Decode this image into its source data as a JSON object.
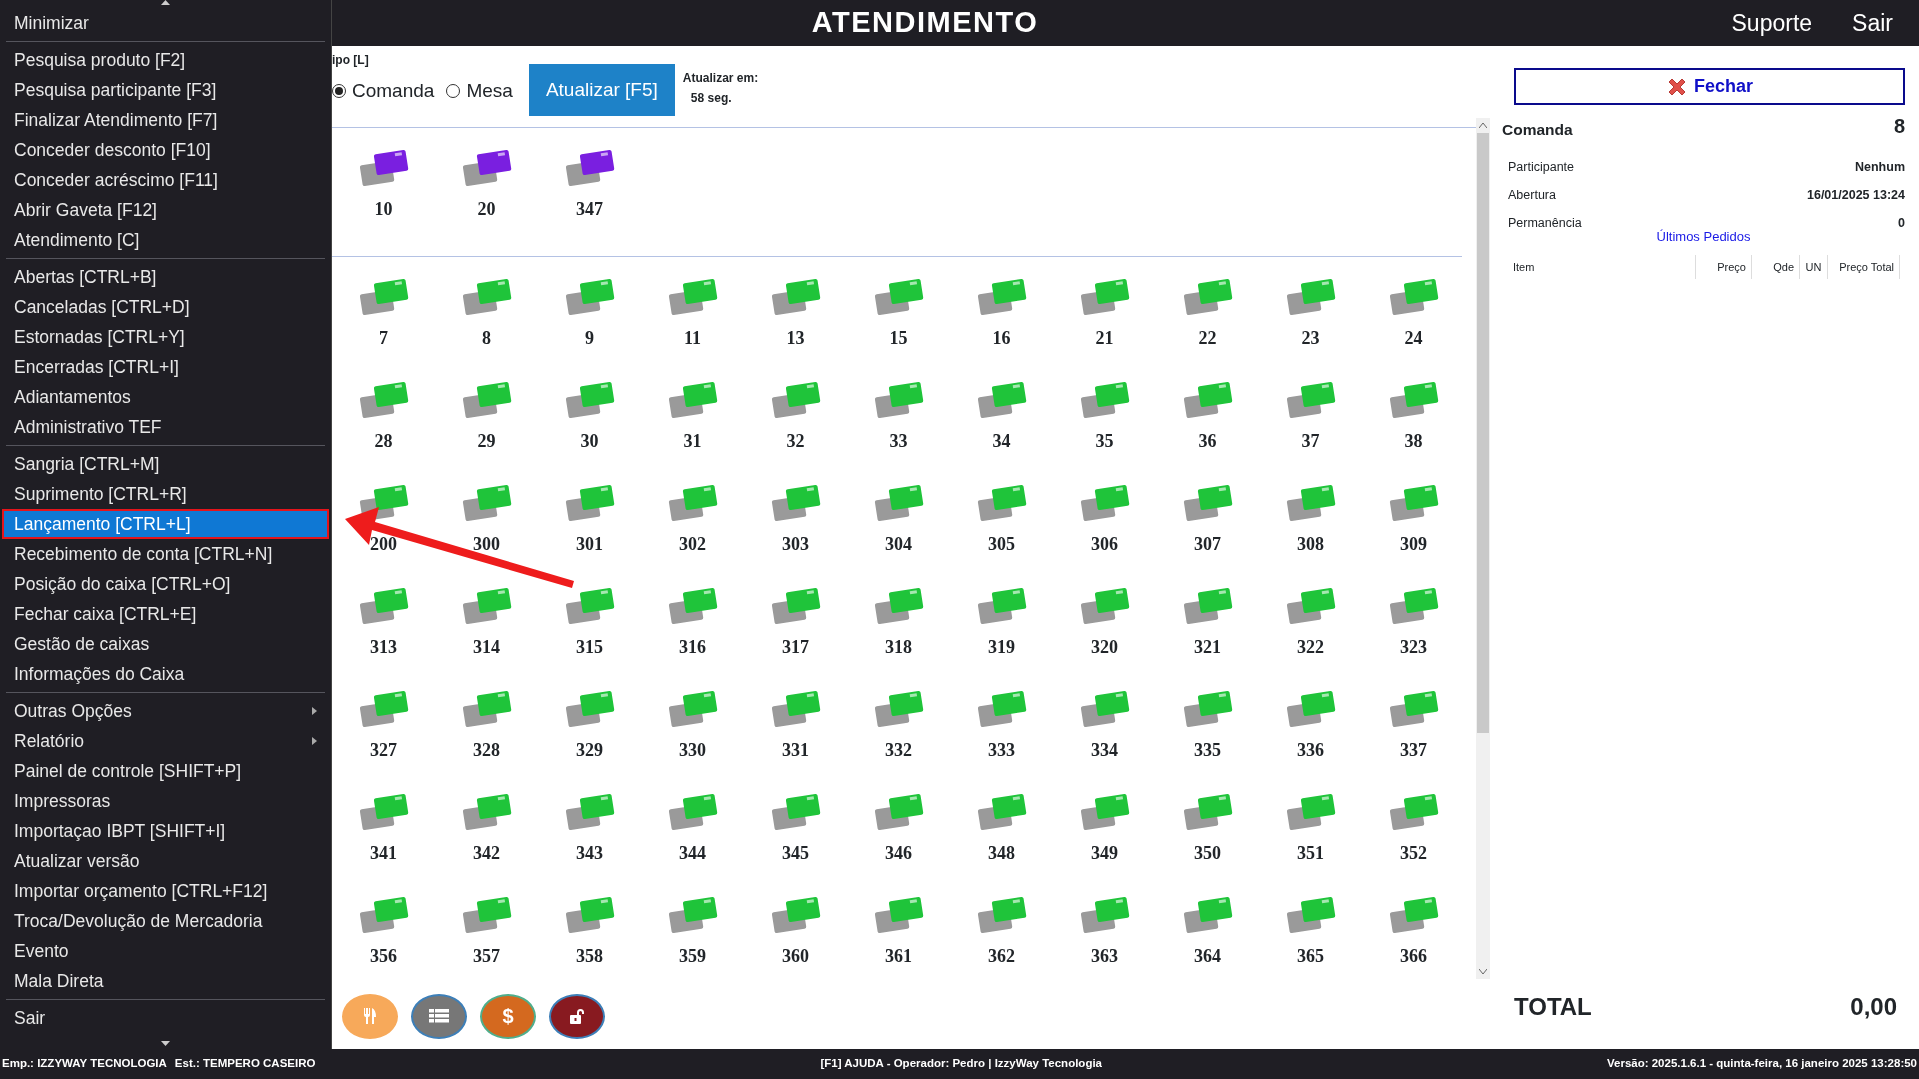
{
  "menu": {
    "groups": [
      {
        "items": [
          {
            "label": "Minimizar",
            "selected": false,
            "submenu": false
          }
        ]
      },
      {
        "items": [
          {
            "label": "Pesquisa produto [F2]",
            "selected": false,
            "submenu": false
          },
          {
            "label": "Pesquisa participante [F3]",
            "selected": false,
            "submenu": false
          },
          {
            "label": "Finalizar Atendimento [F7]",
            "selected": false,
            "submenu": false
          },
          {
            "label": "Conceder desconto [F10]",
            "selected": false,
            "submenu": false
          },
          {
            "label": "Conceder acréscimo [F11]",
            "selected": false,
            "submenu": false
          },
          {
            "label": "Abrir Gaveta [F12]",
            "selected": false,
            "submenu": false
          },
          {
            "label": "Atendimento [C]",
            "selected": false,
            "submenu": false
          }
        ]
      },
      {
        "items": [
          {
            "label": "Abertas [CTRL+B]",
            "selected": false,
            "submenu": false
          },
          {
            "label": "Canceladas [CTRL+D]",
            "selected": false,
            "submenu": false
          },
          {
            "label": "Estornadas [CTRL+Y]",
            "selected": false,
            "submenu": false
          },
          {
            "label": "Encerradas [CTRL+I]",
            "selected": false,
            "submenu": false
          },
          {
            "label": "Adiantamentos",
            "selected": false,
            "submenu": false
          },
          {
            "label": "Administrativo TEF",
            "selected": false,
            "submenu": false
          }
        ]
      },
      {
        "items": [
          {
            "label": "Sangria [CTRL+M]",
            "selected": false,
            "submenu": false
          },
          {
            "label": "Suprimento [CTRL+R]",
            "selected": false,
            "submenu": false
          },
          {
            "label": "Lançamento [CTRL+L]",
            "selected": true,
            "submenu": false
          },
          {
            "label": "Recebimento de conta [CTRL+N]",
            "selected": false,
            "submenu": false
          },
          {
            "label": "Posição do caixa [CTRL+O]",
            "selected": false,
            "submenu": false
          },
          {
            "label": "Fechar caixa [CTRL+E]",
            "selected": false,
            "submenu": false
          },
          {
            "label": "Gestão de caixas",
            "selected": false,
            "submenu": false
          },
          {
            "label": "Informações do Caixa",
            "selected": false,
            "submenu": false
          }
        ]
      },
      {
        "items": [
          {
            "label": "Outras Opções",
            "selected": false,
            "submenu": true
          },
          {
            "label": "Relatório",
            "selected": false,
            "submenu": true
          },
          {
            "label": "Painel de controle [SHIFT+P]",
            "selected": false,
            "submenu": false
          },
          {
            "label": "Impressoras",
            "selected": false,
            "submenu": false
          },
          {
            "label": "Importaçao IBPT [SHIFT+I]",
            "selected": false,
            "submenu": false
          },
          {
            "label": "Atualizar versão",
            "selected": false,
            "submenu": false
          },
          {
            "label": "Importar orçamento [CTRL+F12]",
            "selected": false,
            "submenu": false
          },
          {
            "label": "Troca/Devolução de Mercadoria",
            "selected": false,
            "submenu": false
          },
          {
            "label": "Evento",
            "selected": false,
            "submenu": false
          },
          {
            "label": "Mala Direta",
            "selected": false,
            "submenu": false
          }
        ]
      },
      {
        "items": [
          {
            "label": "Sair",
            "selected": false,
            "submenu": false
          }
        ]
      }
    ]
  },
  "header": {
    "title": "ATENDIMENTO",
    "links": [
      "Suporte",
      "Sair"
    ]
  },
  "toolbar": {
    "type_label": "ipo [L]",
    "radios": [
      {
        "label": "Comanda",
        "selected": true
      },
      {
        "label": "Mesa",
        "selected": false
      }
    ],
    "refresh_button": "Atualizar [F5]",
    "refresh_label": "Atualizar em:",
    "refresh_time": "58 seg."
  },
  "sections": [
    {
      "color": "#7a1fe0",
      "items": [
        "10",
        "20",
        "347"
      ]
    },
    {
      "color": "#1fc43a",
      "items": [
        "7",
        "8",
        "9",
        "11",
        "13",
        "15",
        "16",
        "21",
        "22",
        "23",
        "24",
        "28",
        "29",
        "30",
        "31",
        "32",
        "33",
        "34",
        "35",
        "36",
        "37",
        "38",
        "200",
        "300",
        "301",
        "302",
        "303",
        "304",
        "305",
        "306",
        "307",
        "308",
        "309",
        "313",
        "314",
        "315",
        "316",
        "317",
        "318",
        "319",
        "320",
        "321",
        "322",
        "323",
        "327",
        "328",
        "329",
        "330",
        "331",
        "332",
        "333",
        "334",
        "335",
        "336",
        "337",
        "341",
        "342",
        "343",
        "344",
        "345",
        "346",
        "348",
        "349",
        "350",
        "351",
        "352",
        "356",
        "357",
        "358",
        "359",
        "360",
        "361",
        "362",
        "363",
        "364",
        "365",
        "366"
      ]
    }
  ],
  "action_buttons": [
    {
      "kind": "cutlery"
    },
    {
      "kind": "list"
    },
    {
      "kind": "cash",
      "label": "$"
    },
    {
      "kind": "unlock"
    }
  ],
  "detail": {
    "close_button": "Fechar",
    "title": "Comanda",
    "number": "8",
    "fields": [
      {
        "label": "Participante",
        "value": "Nenhum"
      },
      {
        "label": "Abertura",
        "value": "16/01/2025 13:24"
      },
      {
        "label": "Permanência",
        "value": "0"
      }
    ],
    "orders_title": "Últimos Pedidos",
    "columns": [
      "Item",
      "Preço",
      "Qde",
      "UN",
      "Preço Total"
    ],
    "total_label": "TOTAL",
    "total_value": "0,00"
  },
  "status_bar": {
    "left": [
      "Emp.: IZZYWAY TECNOLOGIA",
      "Est.: TEMPERO CASEIRO"
    ],
    "center": "[F1] AJUDA - Operador: Pedro | IzzyWay Tecnologia",
    "right": "Versão: 2025.1.6.1 - quinta-feira, 16 janeiro 2025 13:28:50"
  }
}
